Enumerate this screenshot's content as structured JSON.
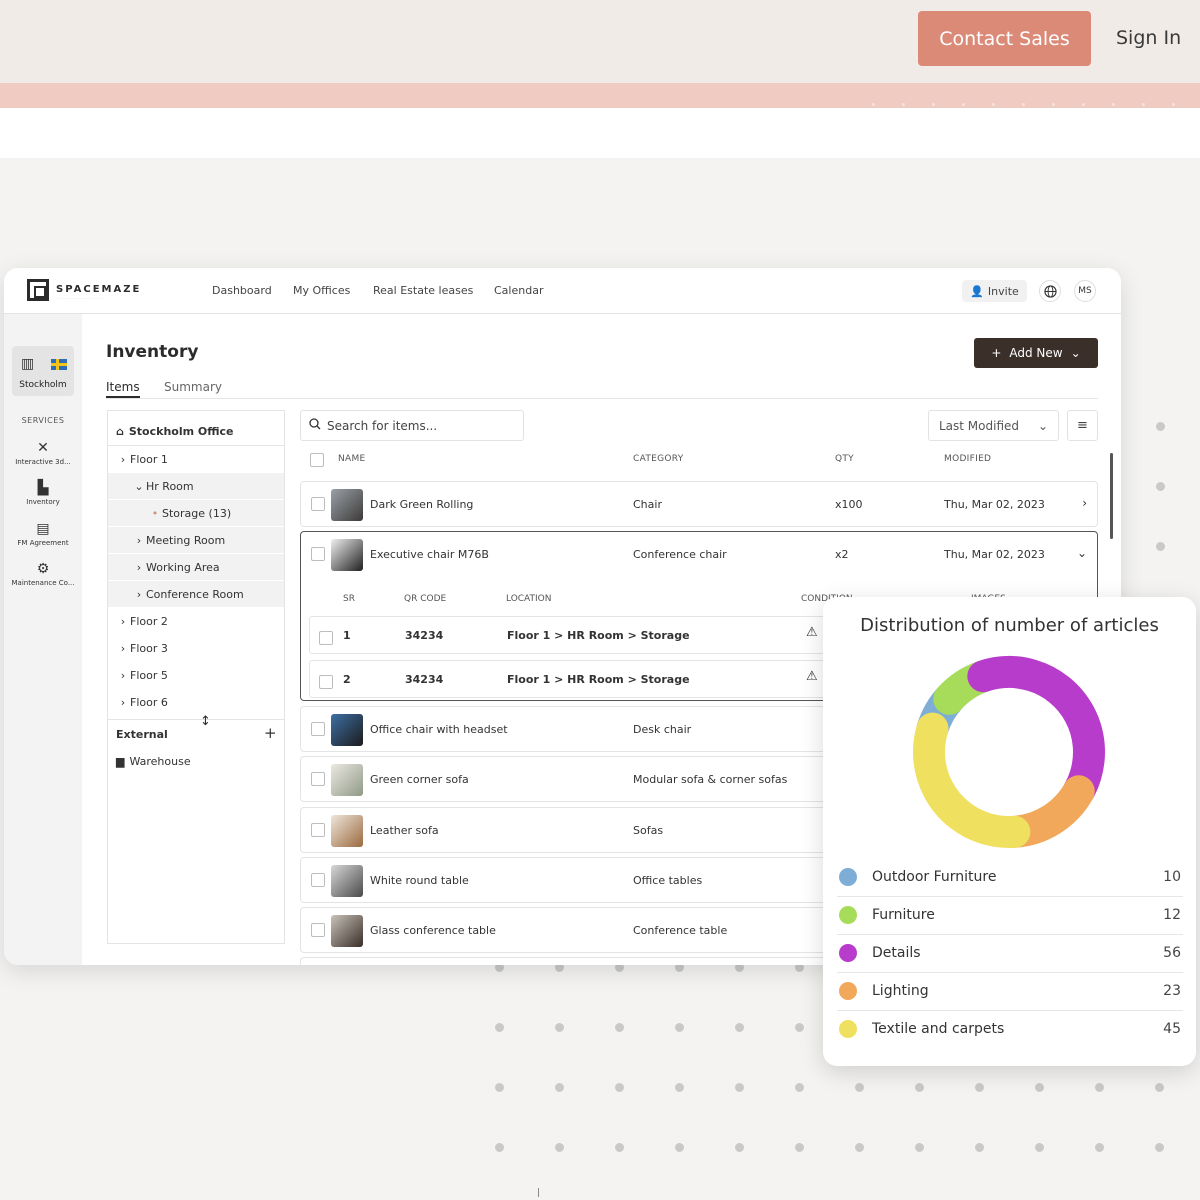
{
  "marketing": {
    "contact_label": "Contact Sales",
    "signin_label": "Sign In"
  },
  "app": {
    "logo_text": "SPACEMAZE",
    "nav": [
      "Dashboard",
      "My Offices",
      "Real Estate leases",
      "Calendar"
    ],
    "invite_label": "Invite",
    "avatar_initials": "MS",
    "sidebar": {
      "location_label": "Stockholm",
      "services_label": "SERVICES",
      "services": [
        {
          "label": "Interactive 3d...",
          "icon": "tools-icon"
        },
        {
          "label": "Inventory",
          "icon": "boxes-icon"
        },
        {
          "label": "FM Agreement",
          "icon": "document-icon"
        },
        {
          "label": "Maintenance Co...",
          "icon": "maintenance-icon"
        }
      ]
    },
    "page_title": "Inventory",
    "tabs": [
      "Items",
      "Summary"
    ],
    "add_new_label": "Add New",
    "tree": {
      "root": "Stockholm Office",
      "items": [
        "Floor 1",
        "Hr Room",
        "Storage (13)",
        "Meeting Room",
        "Working Area",
        "Conference Room",
        "Floor 2",
        "Floor 3",
        "Floor 5",
        "Floor 6"
      ],
      "external_label": "External",
      "warehouse_label": "Warehouse"
    },
    "search_placeholder": "Search for items...",
    "sort_label": "Last Modified",
    "columns": {
      "name": "NAME",
      "category": "CATEGORY",
      "qty": "QTY",
      "modified": "MODIFIED"
    },
    "sub_columns": {
      "sr": "SR",
      "qr": "QR CODE",
      "location": "LOCATION",
      "condition": "CONDITION",
      "images": "IMAGES"
    },
    "rows": [
      {
        "name": "Dark Green Rolling",
        "category": "Chair",
        "qty": "x100",
        "modified": "Thu, Mar 02, 2023"
      },
      {
        "name": "Executive chair M76B",
        "category": "Conference chair",
        "qty": "x2",
        "modified": "Thu, Mar 02, 2023"
      },
      {
        "name": "Office chair with headset",
        "category": "Desk chair"
      },
      {
        "name": "Green corner sofa",
        "category": "Modular sofa & corner sofas"
      },
      {
        "name": "Leather sofa",
        "category": "Sofas"
      },
      {
        "name": "White round table",
        "category": "Office tables"
      },
      {
        "name": "Glass conference table",
        "category": "Conference table"
      }
    ],
    "sub_rows": [
      {
        "sr": "1",
        "qr": "34234",
        "location": "Floor 1 > HR Room > Storage"
      },
      {
        "sr": "2",
        "qr": "34234",
        "location": "Floor 1 > HR Room > Storage"
      }
    ]
  },
  "chart_data": {
    "type": "pie",
    "title": "Distribution of number of articles",
    "categories": [
      "Outdoor Furniture",
      "Furniture",
      "Details",
      "Lighting",
      "Textile and carpets"
    ],
    "values": [
      10,
      12,
      56,
      23,
      45
    ],
    "colors": [
      "#7eaed6",
      "#a6dc5a",
      "#b83ccc",
      "#f2a85a",
      "#f0e060"
    ]
  }
}
